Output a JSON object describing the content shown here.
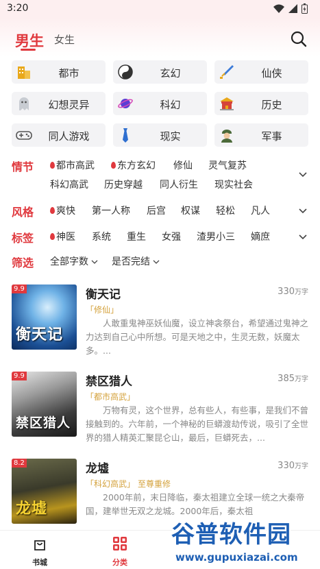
{
  "status": {
    "time": "3:20"
  },
  "header": {
    "male_tab": "男生",
    "female_tab": "女生"
  },
  "categories": [
    {
      "label": "都市",
      "icon": "building-icon",
      "color": "#e9a81a"
    },
    {
      "label": "玄幻",
      "icon": "yin-yang-icon",
      "color": "#333333"
    },
    {
      "label": "仙侠",
      "icon": "sword-icon",
      "color": "#3c7bd8"
    },
    {
      "label": "幻想灵异",
      "icon": "ghost-icon",
      "color": "#9aa0a8"
    },
    {
      "label": "科幻",
      "icon": "planet-icon",
      "color": "#5b3fd4"
    },
    {
      "label": "历史",
      "icon": "palace-icon",
      "color": "#d5443a"
    },
    {
      "label": "同人游戏",
      "icon": "gamepad-icon",
      "color": "#555555"
    },
    {
      "label": "现实",
      "icon": "tie-icon",
      "color": "#2f6fd0"
    },
    {
      "label": "军事",
      "icon": "soldier-icon",
      "color": "#4c6a3a"
    }
  ],
  "filters": {
    "plot": {
      "name": "情节",
      "options": [
        "都市高武",
        "东方玄幻",
        "修仙",
        "灵气复苏",
        "科幻高武",
        "历史穿越",
        "同人衍生",
        "现实社会"
      ]
    },
    "style": {
      "name": "风格",
      "options": [
        "爽快",
        "第一人称",
        "后宫",
        "权谋",
        "轻松",
        "凡人"
      ]
    },
    "tags": {
      "name": "标签",
      "options": [
        "神医",
        "系统",
        "重生",
        "女强",
        "渣男小三",
        "嫡庶"
      ]
    },
    "screen": {
      "name": "筛选",
      "word_count": "全部字数",
      "finished": "是否完结"
    }
  },
  "books": [
    {
      "score": "9.9",
      "title": "衡天记",
      "cover_text": "衡天记",
      "count": "330",
      "unit": "万字",
      "tag": "「修仙」",
      "extra": "",
      "desc": "人敢重鬼神巫妖仙魔，设立神衾祭台，希望通过鬼神之力达到自己心中所想。可是天地之中，生灵无数，妖魔太多。..."
    },
    {
      "score": "9.9",
      "title": "禁区猎人",
      "cover_text": "禁区猎人",
      "count": "385",
      "unit": "万字",
      "tag": "「都市高武」",
      "extra": "",
      "desc": "万物有灵，这个世界，总有些人，有些事，是我们不曾接触到的。六年前，一个神秘的巨蟒渡劫传说，吸引了全世界的猎人精英汇聚昆仑山，最后，巨蟒死去，..."
    },
    {
      "score": "8.2",
      "title": "龙墟",
      "cover_text": "龙墟",
      "count": "330",
      "unit": "万字",
      "tag": "「科幻高武」",
      "extra": "至尊重修",
      "desc": "2000年前，末日降临，秦太祖建立全球一统之大秦帝国，建举世无双之龙城。2000年后，秦太祖"
    }
  ],
  "bottom_nav": [
    {
      "label": "书城",
      "icon": "bag-icon"
    },
    {
      "label": "分类",
      "icon": "grid-icon"
    }
  ],
  "watermark": {
    "main": "谷普软件园",
    "url": "www.gupuxiazai.com"
  },
  "colors": {
    "accent": "#e0393e",
    "tag": "#d4a23c",
    "muted": "#888888"
  }
}
